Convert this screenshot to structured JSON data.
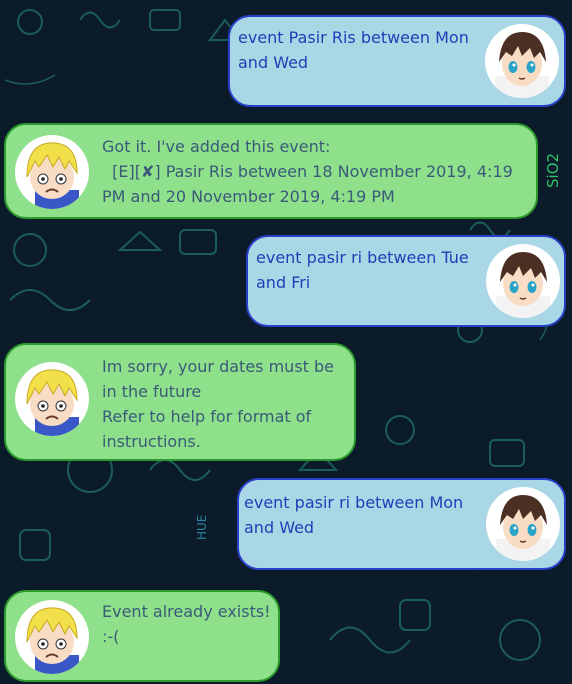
{
  "messages": [
    {
      "sender": "user",
      "text": "event Pasir Ris between Mon\nand Wed",
      "avatar": "dark-haired-boy-icon"
    },
    {
      "sender": "bot",
      "text": "Got it. I've added this event:\n  [E][✘] Pasir Ris between 18 November 2019, 4:19\nPM and 20 November 2019, 4:19 PM",
      "avatar": "blond-worried-boy-icon"
    },
    {
      "sender": "user",
      "text": "event pasir ri between Tue\nand Fri",
      "avatar": "dark-haired-boy-icon"
    },
    {
      "sender": "bot",
      "text": "Im sorry, your dates must be\nin the future\nRefer to help for format of\ninstructions.",
      "avatar": "blond-worried-boy-icon"
    },
    {
      "sender": "user",
      "text": "event pasir ri between Mon\nand Wed",
      "avatar": "dark-haired-boy-icon"
    },
    {
      "sender": "bot",
      "text": "Event already exists!\n:-(",
      "avatar": "blond-worried-boy-icon"
    }
  ],
  "background": {
    "doodles": [
      "SiO2",
      "HUE"
    ]
  },
  "colors": {
    "background": "#0b1b2a",
    "user_bubble": "#a9d7e6",
    "user_border": "#2a3fc9",
    "user_text": "#1f3fb7",
    "bot_bubble": "#8fe08a",
    "bot_border": "#2c9a2c",
    "bot_text": "#3a5a7a"
  }
}
